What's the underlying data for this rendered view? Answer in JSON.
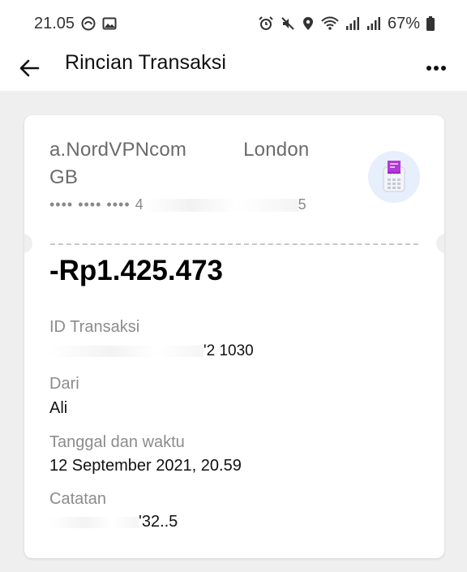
{
  "status_bar": {
    "time": "21.05",
    "battery": "67%",
    "icons": [
      "whatsapp-icon",
      "gallery-icon",
      "alarm-icon",
      "mute-icon",
      "location-icon",
      "wifi-icon",
      "signal-icon",
      "signal-icon",
      "battery-icon"
    ]
  },
  "header": {
    "title": "Rincian Transaksi",
    "back_icon": "arrow-left-icon",
    "more_icon": "more-horizontal-icon"
  },
  "transaction": {
    "merchant_name": "a.NordVPNcom",
    "merchant_city": "London",
    "merchant_country": "GB",
    "card_prefix": "•••• •••• •••• 4",
    "card_suffix": "5",
    "merchant_icon": "payment-terminal-icon",
    "amount": "-Rp1.425.473",
    "fields": {
      "id_label": "ID Transaksi",
      "id_value": "'2 1030",
      "from_label": "Dari",
      "from_value": "Ali",
      "datetime_label": "Tanggal dan waktu",
      "datetime_value": "12 September 2021, 20.59",
      "note_label": "Catatan",
      "note_value": "'32..5"
    }
  },
  "colors": {
    "background": "#efefef",
    "card": "#ffffff",
    "icon_accent": "#b23ad6",
    "icon_bg": "#e7eefc"
  }
}
